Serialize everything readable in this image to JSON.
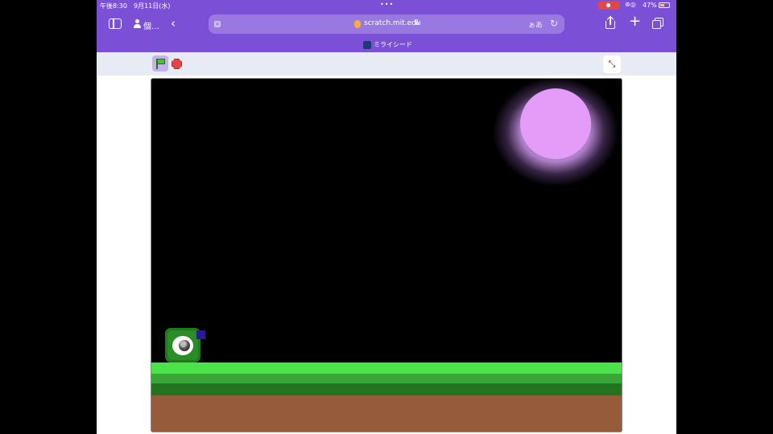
{
  "status_bar": {
    "time": "午後8:30",
    "date": "9月11日(水)",
    "battery": "47%",
    "battery_level": 0.47
  },
  "toolbar": {
    "profile_label": "個…",
    "url": "scratch.mit.edu",
    "translate_label": "ぁあ"
  },
  "tab": {
    "title": "ミライシード"
  },
  "scratch": {
    "green_flag": "green-flag-icon",
    "stop": "stop-icon",
    "fullscreen": "exit-fullscreen-icon"
  },
  "stage": {
    "moon_color": "#e49cf8",
    "grass_color": "#4ce24a",
    "dirt_color": "#965b3a",
    "background": "#000000"
  }
}
